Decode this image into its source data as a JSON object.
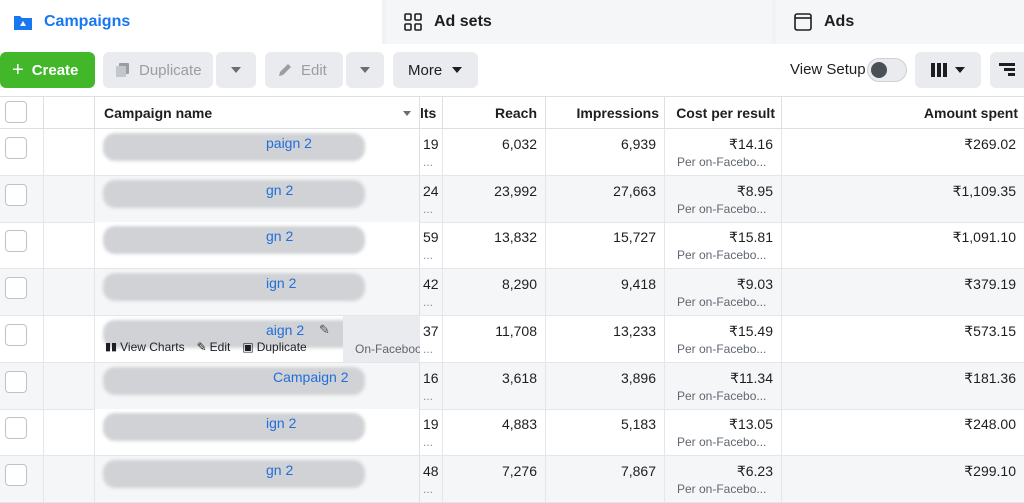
{
  "tabs": [
    {
      "label": "Campaigns",
      "active": true
    },
    {
      "label": "Ad sets",
      "active": false
    },
    {
      "label": "Ads",
      "active": false
    }
  ],
  "toolbar": {
    "create_label": "Create",
    "duplicate_label": "Duplicate",
    "edit_label": "Edit",
    "more_label": "More",
    "view_setup_label": "View Setup"
  },
  "columns": {
    "campaign_name": "Campaign name",
    "results": "lts",
    "reach": "Reach",
    "impressions": "Impressions",
    "cost_per_result": "Cost per result",
    "amount_spent": "Amount spent"
  },
  "hover_actions": {
    "view_charts": "View Charts",
    "edit": "Edit",
    "duplicate": "Duplicate"
  },
  "rows": [
    {
      "name_suffix": "paign 2",
      "results": "19",
      "reach": "6,032",
      "impressions": "6,939",
      "cost": "₹14.16",
      "cost_sub": "Per on-Facebo...",
      "spent": "₹269.02"
    },
    {
      "name_suffix": "gn 2",
      "results": "24",
      "reach": "23,992",
      "impressions": "27,663",
      "cost": "₹8.95",
      "cost_sub": "Per on-Facebo...",
      "spent": "₹1,109.35"
    },
    {
      "name_suffix": "gn 2",
      "results": "59",
      "reach": "13,832",
      "impressions": "15,727",
      "cost": "₹15.81",
      "cost_sub": "Per on-Facebo...",
      "spent": "₹1,091.10"
    },
    {
      "name_suffix": "ign 2",
      "results": "42",
      "reach": "8,290",
      "impressions": "9,418",
      "cost": "₹9.03",
      "cost_sub": "Per on-Facebo...",
      "spent": "₹379.19"
    },
    {
      "name_suffix": "aign 2",
      "results": "37",
      "reach": "11,708",
      "impressions": "13,233",
      "cost": "₹15.49",
      "cost_sub": "Per on-Facebo...",
      "spent": "₹573.15",
      "results_sub": "On-Faceboo..."
    },
    {
      "name_suffix": "Campaign 2",
      "results": "16",
      "reach": "3,618",
      "impressions": "3,896",
      "cost": "₹11.34",
      "cost_sub": "Per on-Facebo...",
      "spent": "₹181.36"
    },
    {
      "name_suffix": "ign 2",
      "results": "19",
      "reach": "4,883",
      "impressions": "5,183",
      "cost": "₹13.05",
      "cost_sub": "Per on-Facebo...",
      "spent": "₹248.00"
    },
    {
      "name_suffix": "gn 2",
      "results": "48",
      "reach": "7,276",
      "impressions": "7,867",
      "cost": "₹6.23",
      "cost_sub": "Per on-Facebo...",
      "spent": "₹299.10"
    }
  ],
  "colors": {
    "accent": "#1877f2",
    "create": "#42b72a",
    "link": "#216fdb"
  }
}
